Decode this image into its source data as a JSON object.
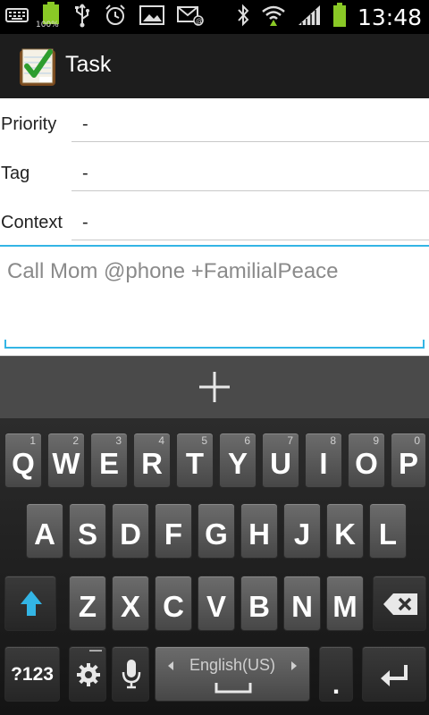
{
  "status_bar": {
    "time": "13:48",
    "battery_percent": "100%",
    "icons": [
      "keyboard-icon",
      "battery-icon",
      "usb-icon",
      "alarm-icon",
      "gallery-icon",
      "email-icon",
      "bluetooth-icon",
      "wifi-icon",
      "signal-icon",
      "battery-charging-icon"
    ]
  },
  "action_bar": {
    "title": "Task",
    "icon": "task-checklist-icon"
  },
  "fields": [
    {
      "label": "Priority",
      "value": "-"
    },
    {
      "label": "Tag",
      "value": "-"
    },
    {
      "label": "Context",
      "value": "-"
    }
  ],
  "note": {
    "text": "Call Mom @phone +FamilialPeace"
  },
  "add_bar": {
    "icon": "plus-icon"
  },
  "colors": {
    "accent": "#33b5e5",
    "shift_blue": "#33b5e5"
  },
  "keyboard": {
    "row1": [
      {
        "key": "Q",
        "hint": "1"
      },
      {
        "key": "W",
        "hint": "2"
      },
      {
        "key": "E",
        "hint": "3"
      },
      {
        "key": "R",
        "hint": "4"
      },
      {
        "key": "T",
        "hint": "5"
      },
      {
        "key": "Y",
        "hint": "6"
      },
      {
        "key": "U",
        "hint": "7"
      },
      {
        "key": "I",
        "hint": "8"
      },
      {
        "key": "O",
        "hint": "9"
      },
      {
        "key": "P",
        "hint": "0"
      }
    ],
    "row2": [
      "A",
      "S",
      "D",
      "F",
      "G",
      "H",
      "J",
      "K",
      "L"
    ],
    "row3": [
      "Z",
      "X",
      "C",
      "V",
      "B",
      "N",
      "M"
    ],
    "symbols_label": "?123",
    "language_label": "English(US)",
    "period_label": ".",
    "shift_icon": "shift-icon",
    "backspace_icon": "backspace-icon",
    "settings_icon": "gear-icon",
    "mic_icon": "microphone-icon",
    "enter_icon": "enter-icon"
  }
}
